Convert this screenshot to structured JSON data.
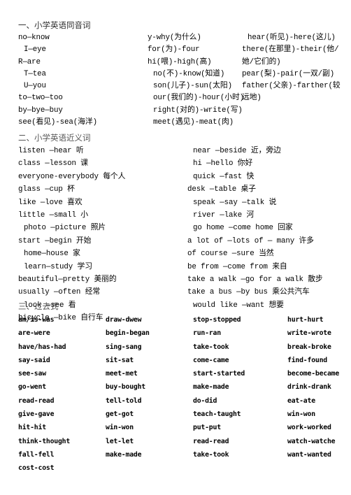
{
  "document": {
    "sections": [
      {
        "id": "homophones",
        "heading": "一、小学英语同音词",
        "columns": [
          {
            "id": "homophone-col-1",
            "rows": [
              {
                "text": "no—know",
                "indent": false
              },
              {
                "text": "I—eye",
                "indent": true
              },
              {
                "text": "R—are",
                "indent": false
              },
              {
                "text": "T—tea",
                "indent": true
              },
              {
                "text": "U—you",
                "indent": true
              },
              {
                "text": "to—two—too",
                "indent": false
              },
              {
                "text": "by—bye—buy",
                "indent": false
              },
              {
                "text": "see(看见)-sea(海洋)",
                "indent": false
              }
            ]
          },
          {
            "id": "homophone-col-2",
            "rows": [
              {
                "text": "y-why(为什么)",
                "indent": false
              },
              {
                "text": "for(为)-four",
                "indent": false
              },
              {
                "text": "hi(喂)-high(高)",
                "indent": false
              },
              {
                "text": "no(不)-know(知道)",
                "indent": true
              },
              {
                "text": "son(儿子)-sun(太阳)",
                "indent": true
              },
              {
                "text": "our(我们的)-hour(小时)",
                "indent": true
              },
              {
                "text": "right(对的)-write(写)",
                "indent": true
              },
              {
                "text": "meet(遇见)-meat(肉)",
                "indent": true
              }
            ]
          },
          {
            "id": "homophone-col-3",
            "rows": [
              {
                "text": "hear(听见)-here(这儿)",
                "indent": true
              },
              {
                "text": "there(在那里)-their(他/",
                "indent": false
              },
              {
                "text": "她/它们的)",
                "indent": false
              },
              {
                "text": "pear(梨)-pair(一双/副)",
                "indent": false
              },
              {
                "text": "father(父亲)-farther(较",
                "indent": false
              },
              {
                "text": "远地)",
                "indent": false
              }
            ]
          }
        ]
      },
      {
        "id": "synonyms",
        "heading": "二、小学英语近义词",
        "columns": [
          {
            "id": "synonym-col-left",
            "rows": [
              {
                "text": "listen —hear  听",
                "indent": false
              },
              {
                "text": "class —lesson  课",
                "indent": false
              },
              {
                "text": "everyone-everybody 每个人",
                "indent": false
              },
              {
                "text": "glass —cup  杯",
                "indent": false
              },
              {
                "text": "like —love   喜欢",
                "indent": false
              },
              {
                "text": "little —small 小",
                "indent": false
              },
              {
                "text": "photo —picture   照片",
                "indent": true
              },
              {
                "text": "start —begin 开始",
                "indent": false
              },
              {
                "text": "home—house    家",
                "indent": true
              },
              {
                "text": "learn—study   学习",
                "indent": true
              },
              {
                "text": "beautiful—pretty 美丽的",
                "indent": false
              },
              {
                "text": "usually —often     经常",
                "indent": false
              },
              {
                "text": "look —see   看",
                "indent": true
              },
              {
                "text": "bicycle —bike 自行车",
                "indent": false
              }
            ]
          },
          {
            "id": "synonym-col-right",
            "rows": [
              {
                "text": "near —beside   近，旁边",
                "indent": true
              },
              {
                "text": "hi —hello   你好",
                "indent": true
              },
              {
                "text": "quick —fast   快",
                "indent": true
              },
              {
                "text": "desk —table   桌子",
                "indent": false
              },
              {
                "text": "speak —say —talk 说",
                "indent": true
              },
              {
                "text": "river —lake  河",
                "indent": true
              },
              {
                "text": "go home —come home 回家",
                "indent": true
              },
              {
                "text": "a lot of —lots of — many    许多",
                "indent": false
              },
              {
                "text": "of course —sure  当然",
                "indent": false
              },
              {
                "text": "be from  —come from 来自",
                "indent": false
              },
              {
                "text": "take a walk —go for a walk 散步",
                "indent": false
              },
              {
                "text": "take a bus —by bus  乘公共汽车",
                "indent": false
              },
              {
                "text": "would like —want  想要",
                "indent": true
              }
            ]
          }
        ]
      },
      {
        "id": "past-tense",
        "heading": "三、过去式",
        "verb_rows": [
          [
            "am/is-was",
            "draw-dwew",
            "stop-stopped",
            "hurt-hurt"
          ],
          [
            "are-were",
            "begin-began",
            "run-ran",
            "write-wrote"
          ],
          [
            "have/has-had",
            "sing-sang",
            "take-took",
            "break-broke"
          ],
          [
            "say-said",
            "sit-sat",
            "come-came",
            "find-found"
          ],
          [
            "see-saw",
            "meet-met",
            "start-started",
            "become-became"
          ],
          [
            "go-went",
            "buy-bought",
            "make-made",
            "drink-drank"
          ],
          [
            "read-read",
            "tell-told",
            "do-did",
            "eat-ate"
          ],
          [
            "give-gave",
            "get-got",
            "teach-taught",
            "win-won"
          ],
          [
            "hit-hit",
            "win-won",
            "put-put",
            "work-worked"
          ],
          [
            "think-thought",
            "let-let",
            "read-read",
            "watch-watche"
          ],
          [
            "fall-fell",
            "make-made",
            "take-took",
            "want-wanted"
          ],
          [
            "cost-cost",
            "",
            "",
            ""
          ]
        ]
      }
    ]
  }
}
